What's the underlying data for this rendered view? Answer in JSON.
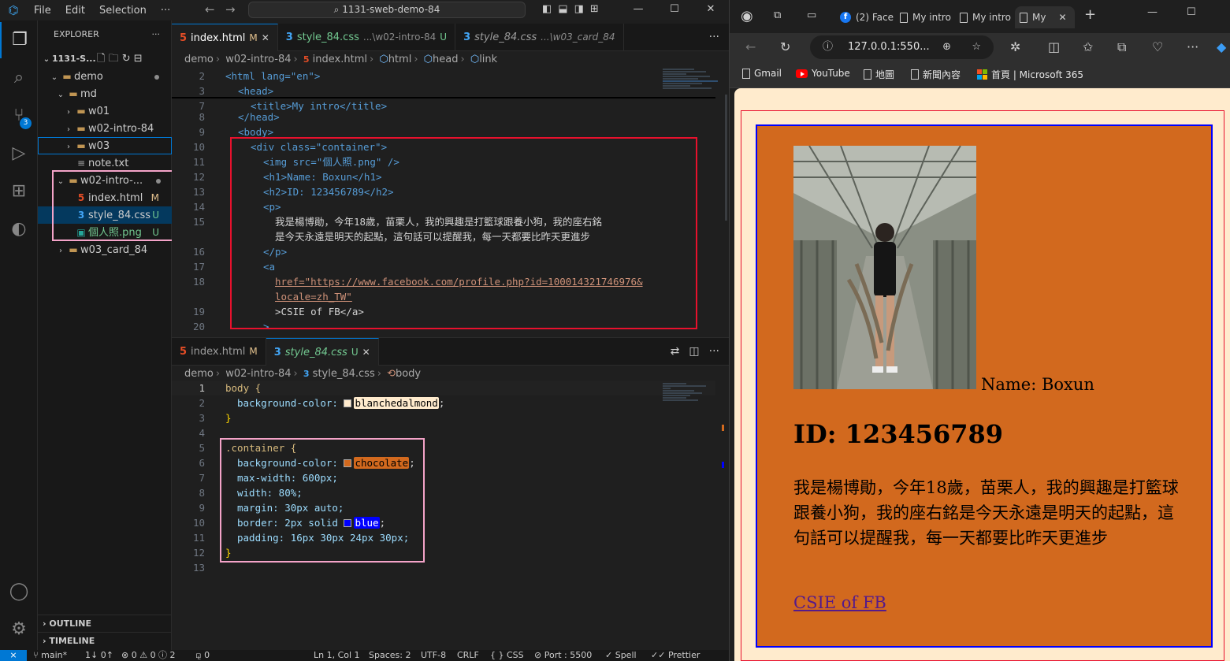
{
  "vscode": {
    "menu": [
      "File",
      "Edit",
      "Selection",
      "···"
    ],
    "search": "1131-sweb-demo-84",
    "explorer_title": "EXPLORER",
    "workspace": "1131-S...",
    "tree": [
      {
        "label": "demo",
        "status": "dot"
      },
      {
        "label": "md",
        "status": ""
      },
      {
        "label": "w01",
        "status": ""
      },
      {
        "label": "w02-intro-84",
        "status": ""
      },
      {
        "label": "w03",
        "status": ""
      },
      {
        "label": "note.txt",
        "status": ""
      },
      {
        "label": "w02-intro-...",
        "status": "dot"
      },
      {
        "label": "index.html",
        "status": "M"
      },
      {
        "label": "style_84.css",
        "status": "U"
      },
      {
        "label": "個人照.png",
        "status": "U"
      },
      {
        "label": "w03_card_84",
        "status": ""
      }
    ],
    "outline": "OUTLINE",
    "timeline": "TIMELINE",
    "scm_badge": "3",
    "top_tabs": [
      {
        "name": "index.html",
        "flag": "M"
      },
      {
        "name": "style_84.css",
        "path": "...\\w02-intro-84",
        "flag": "U"
      },
      {
        "name": "style_84.css",
        "path": "...\\w03_card_84",
        "flag": ""
      }
    ],
    "top_breadcrumb": [
      "demo",
      "w02-intro-84",
      "index.html",
      "html",
      "head",
      "link"
    ],
    "bottom_tabs": [
      {
        "name": "index.html",
        "flag": "M"
      },
      {
        "name": "style_84.css",
        "flag": "U"
      }
    ],
    "bottom_breadcrumb": [
      "demo",
      "w02-intro-84",
      "style_84.css",
      "body"
    ],
    "html_lines": {
      "l2": "<html lang=\"en\">",
      "l3": "<head>",
      "l7": "<title>My intro</title>",
      "l8": "</head>",
      "l9": "<body>",
      "l10": "<div class=\"container\">",
      "l11": "<img src=\"個人照.png\" />",
      "l12": "<h1>Name: Boxun</h1>",
      "l13": "<h2>ID: 123456789</h2>",
      "l14": "<p>",
      "l15a": "我是楊博勛，今年18歲，苗栗人，我的興趣是打籃球跟養小狗，我的座右銘",
      "l15b": "是今天永遠是明天的起點，這句話可以提醒我，每一天都要比昨天更進步",
      "l16": "</p>",
      "l17": "<a",
      "l18a": "href=\"https://www.facebook.com/profile.php?id=100014321746976&",
      "l18b": "locale=zh_TW\"",
      "l19": ">CSIE of FB</a>",
      "l20": ">"
    },
    "css_lines": {
      "l1": "body {",
      "l2_prop": "background-color:",
      "l2_val": "blanchedalmond",
      "l3": "}",
      "l5": ".container {",
      "l6_prop": "background-color:",
      "l6_val": "chocolate",
      "l7": "max-width: 600px;",
      "l8": "width: 80%;",
      "l9": "margin: 30px auto;",
      "l10_prop": "border: 2px solid",
      "l10_val": "blue",
      "l11": "padding: 16px 30px 24px 30px;",
      "l12": "}"
    },
    "status": {
      "branch": "main*",
      "sync": "1↓ 0↑",
      "problems": "⊗ 0 ⚠ 0 ⓘ 2",
      "ports": "⚼ 0",
      "position": "Ln 1, Col 1",
      "spaces": "Spaces: 2",
      "encoding": "UTF-8",
      "eol": "CRLF",
      "language": "{ } CSS",
      "port": "Port : 5500",
      "spell": "Spell",
      "prettier": "Prettier"
    }
  },
  "browser": {
    "tabs": [
      "(2) Face",
      "My intro",
      "My intro",
      "My"
    ],
    "address": "127.0.0.1:550...",
    "bookmarks": [
      "Gmail",
      "YouTube",
      "地圖",
      "新聞內容",
      "首頁 | Microsoft 365"
    ],
    "page": {
      "name": "Name: Boxun",
      "id": "ID: 123456789",
      "paragraph": "我是楊博勛，今年18歲，苗栗人，我的興趣是打籃球跟養小狗，我的座右銘是今天永遠是明天的起點，這句話可以提醒我，每一天都要比昨天更進步",
      "link": "CSIE of FB"
    }
  },
  "colors": {
    "page_bg": "#ffebcd",
    "card_bg": "#d2691e",
    "card_border": "#0000ff",
    "accent": "#0078d4",
    "highlight_red": "#e8112d",
    "highlight_pink": "#f4a3c8"
  }
}
